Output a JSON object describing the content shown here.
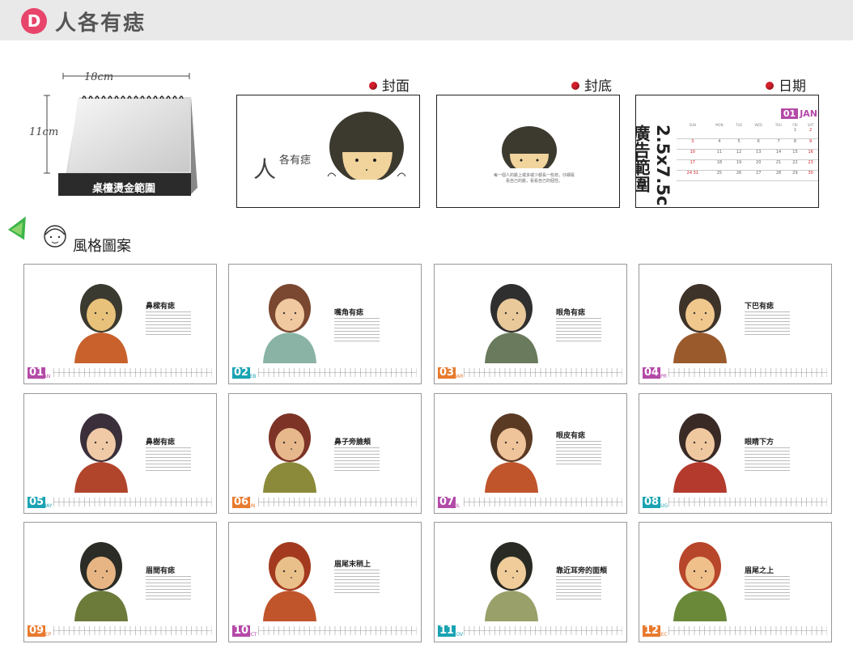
{
  "header": {
    "badge": "D",
    "title": "人各有痣"
  },
  "desk": {
    "width_label": "18cm",
    "height_label": "11cm",
    "gold_label": "桌檯燙金範圍"
  },
  "previews": {
    "cover": {
      "label": "封面",
      "title_big": "人",
      "title_small": "各有痣"
    },
    "back": {
      "label": "封底",
      "text": "每一個人的臉上或多或少都長一些痣，仔細看看自己的臉，看看自己的個性。"
    },
    "date": {
      "label": "日期",
      "ad_area": "2.5x7.5cm廣告範圍",
      "month_num": "01",
      "month_name": "JAN"
    }
  },
  "mini_calendar": {
    "weekdays": [
      "SUN",
      "MON",
      "TUE",
      "WED",
      "THU",
      "FRI",
      "SAT"
    ],
    "weeks": [
      [
        "",
        "",
        "",
        "",
        "",
        "1",
        "2"
      ],
      [
        "3",
        "4",
        "5",
        "6",
        "7",
        "8",
        "9"
      ],
      [
        "10",
        "11",
        "12",
        "13",
        "14",
        "15",
        "16"
      ],
      [
        "17",
        "18",
        "19",
        "20",
        "21",
        "22",
        "23"
      ],
      [
        "24 31",
        "25",
        "26",
        "27",
        "28",
        "29",
        "30"
      ]
    ]
  },
  "style_section": {
    "title": "風格圖案"
  },
  "colors": {
    "badge": "#e8456b",
    "dot": "#d51e2b",
    "jan": "#b44aa8",
    "feb": "#1aa3b3",
    "mar": "#e87a2e",
    "apr": "#b44aa8"
  },
  "cards": [
    {
      "title": "鼻樑有痣",
      "num": "01",
      "name": "JAN",
      "color": "#b44aa8"
    },
    {
      "title": "嘴角有痣",
      "num": "02",
      "name": "FEB",
      "color": "#1aa3b3"
    },
    {
      "title": "眼角有痣",
      "num": "03",
      "name": "MAR",
      "color": "#e87a2e"
    },
    {
      "title": "下巴有痣",
      "num": "04",
      "name": "APR",
      "color": "#b44aa8"
    },
    {
      "title": "鼻樹有痣",
      "num": "05",
      "name": "MAY",
      "color": "#1aa3b3"
    },
    {
      "title": "鼻子旁臉頰",
      "num": "06",
      "name": "JUN",
      "color": "#e87a2e"
    },
    {
      "title": "眼皮有痣",
      "num": "07",
      "name": "JUL",
      "color": "#b44aa8"
    },
    {
      "title": "眼睛下方",
      "num": "08",
      "name": "AUG",
      "color": "#1aa3b3"
    },
    {
      "title": "眉間有痣",
      "num": "09",
      "name": "SEP",
      "color": "#e87a2e"
    },
    {
      "title": "眉尾末稍上",
      "num": "10",
      "name": "OCT",
      "color": "#b44aa8"
    },
    {
      "title": "靠近耳旁的面頰",
      "num": "11",
      "name": "NOV",
      "color": "#1aa3b3"
    },
    {
      "title": "眉尾之上",
      "num": "12",
      "name": "DEC",
      "color": "#e87a2e"
    }
  ]
}
